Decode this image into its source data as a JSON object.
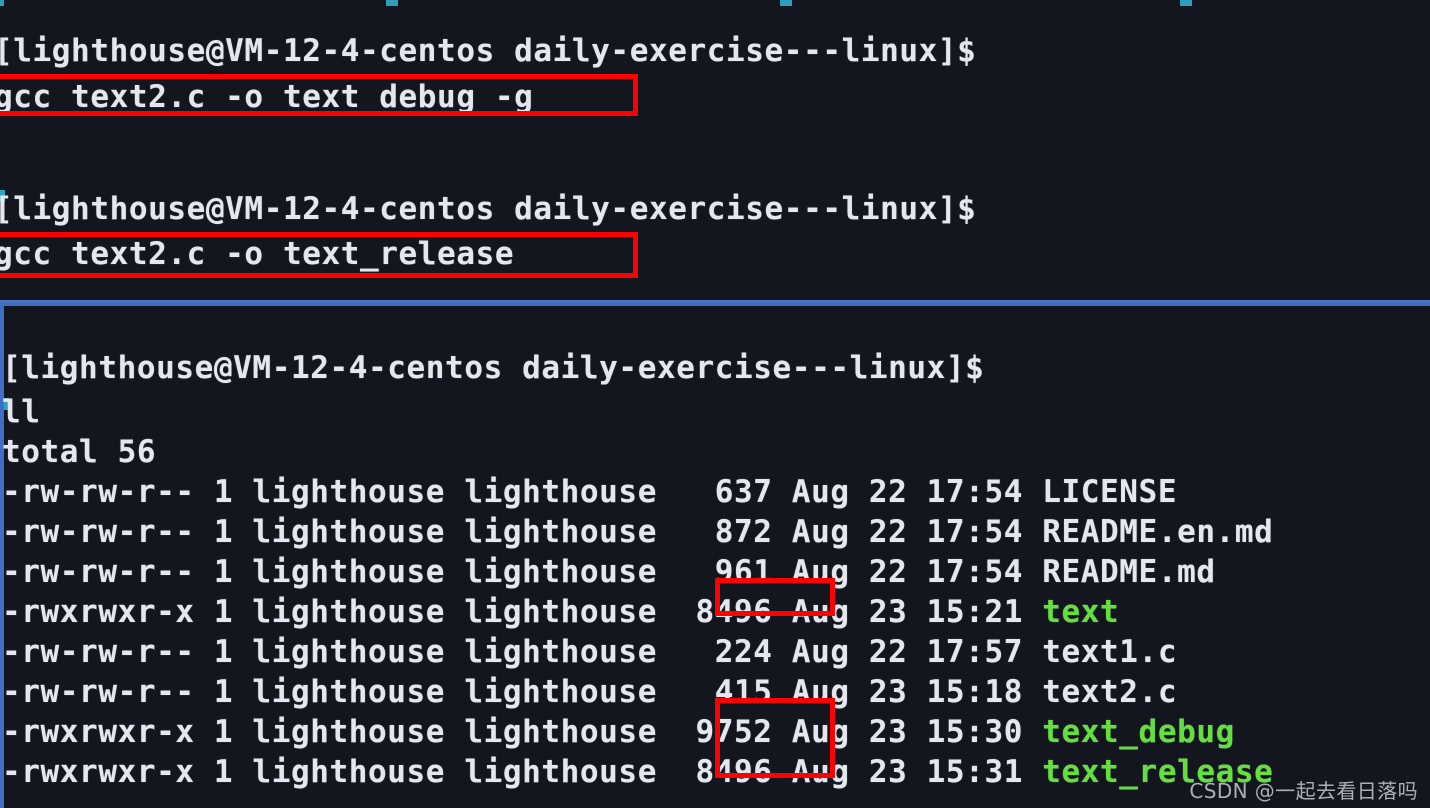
{
  "app": {
    "type": "terminal",
    "shell_prompt": "[lighthouse@VM-12-4-centos daily-exercise---linux]$",
    "colors": {
      "background": "#14161f",
      "foreground": "#e4e7ee",
      "executable_green": "#64e03c",
      "prompt_cyan": "#2fb5d6",
      "annotation_red": "#fe0000",
      "pane_focus_blue": "#3f6ec4"
    }
  },
  "panes": {
    "top": {
      "lines": [
        {
          "prompt": "[lighthouse@VM-12-4-centos daily-exercise---linux]$",
          "command": ""
        },
        {
          "prompt": "",
          "command": "gcc text2.c -o text_debug -g"
        },
        {
          "prompt": "[lighthouse@VM-12-4-centos daily-exercise---linux]$",
          "command": ""
        },
        {
          "prompt": "",
          "command": "gcc text2.c -o text_release"
        }
      ]
    },
    "bottom": {
      "prompt_line": "[lighthouse@VM-12-4-centos daily-exercise---linux]$",
      "command": "ll",
      "total_line": "total 56",
      "listing": [
        {
          "perms": "-rw-rw-r--",
          "links": "1",
          "owner": "lighthouse",
          "group": "lighthouse",
          "size": "637",
          "month": "Aug",
          "day": "22",
          "time": "17:54",
          "name": "LICENSE",
          "is_exec": false
        },
        {
          "perms": "-rw-rw-r--",
          "links": "1",
          "owner": "lighthouse",
          "group": "lighthouse",
          "size": "872",
          "month": "Aug",
          "day": "22",
          "time": "17:54",
          "name": "README.en.md",
          "is_exec": false
        },
        {
          "perms": "-rw-rw-r--",
          "links": "1",
          "owner": "lighthouse",
          "group": "lighthouse",
          "size": "961",
          "month": "Aug",
          "day": "22",
          "time": "17:54",
          "name": "README.md",
          "is_exec": false
        },
        {
          "perms": "-rwxrwxr-x",
          "links": "1",
          "owner": "lighthouse",
          "group": "lighthouse",
          "size": "8496",
          "month": "Aug",
          "day": "23",
          "time": "15:21",
          "name": "text",
          "is_exec": true
        },
        {
          "perms": "-rw-rw-r--",
          "links": "1",
          "owner": "lighthouse",
          "group": "lighthouse",
          "size": "224",
          "month": "Aug",
          "day": "22",
          "time": "17:57",
          "name": "text1.c",
          "is_exec": false
        },
        {
          "perms": "-rw-rw-r--",
          "links": "1",
          "owner": "lighthouse",
          "group": "lighthouse",
          "size": "415",
          "month": "Aug",
          "day": "23",
          "time": "15:18",
          "name": "text2.c",
          "is_exec": false
        },
        {
          "perms": "-rwxrwxr-x",
          "links": "1",
          "owner": "lighthouse",
          "group": "lighthouse",
          "size": "9752",
          "month": "Aug",
          "day": "23",
          "time": "15:30",
          "name": "text_debug",
          "is_exec": true
        },
        {
          "perms": "-rwxrwxr-x",
          "links": "1",
          "owner": "lighthouse",
          "group": "lighthouse",
          "size": "8496",
          "month": "Aug",
          "day": "23",
          "time": "15:31",
          "name": "text_release",
          "is_exec": true
        }
      ]
    }
  },
  "annotations": {
    "boxes": [
      {
        "id": "gcc-debug-command",
        "label": "gcc text2.c -o text_debug -g"
      },
      {
        "id": "gcc-release-command",
        "label": "gcc text2.c -o text_release"
      },
      {
        "id": "text-size",
        "label": "8496"
      },
      {
        "id": "debug-release-sizes",
        "label": "9752 / 8496"
      }
    ]
  },
  "watermark": {
    "text": "CSDN @一起去看日落吗"
  }
}
